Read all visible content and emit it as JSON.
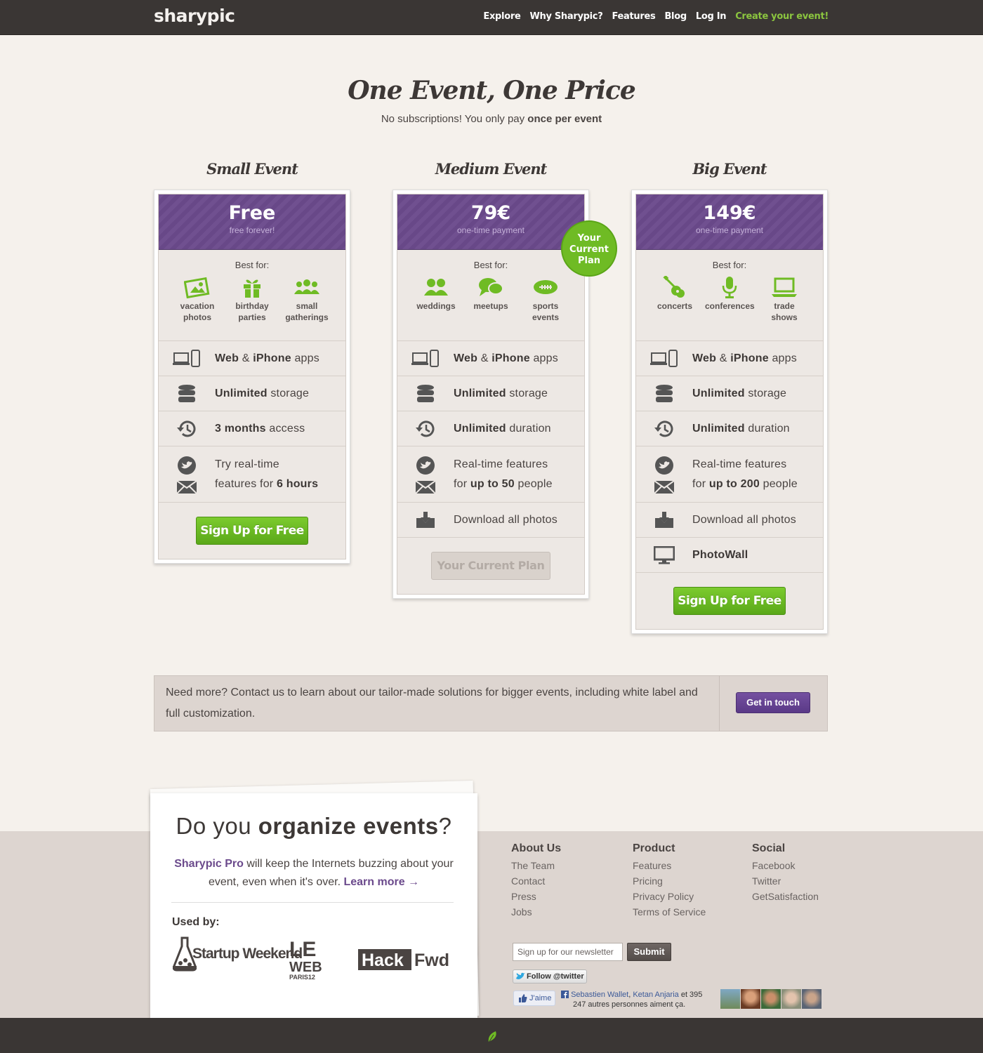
{
  "topbar": {
    "logo": "sharypic",
    "nav": [
      "Explore",
      "Why Sharypic?",
      "Features",
      "Blog",
      "Log In"
    ],
    "cta": "Create your event!"
  },
  "hero": {
    "title": "One Event, One Price",
    "subtitle_pre": "No subscriptions! You only pay ",
    "subtitle_bold": "once per event"
  },
  "plans": [
    {
      "name": "Small Event",
      "price": "Free",
      "price_note": "free forever!",
      "best_for_label": "Best for:",
      "uses": [
        {
          "icon": "vacation-photos-icon",
          "line1": "vacation",
          "line2": "photos"
        },
        {
          "icon": "gift-icon",
          "line1": "birthday",
          "line2": "parties"
        },
        {
          "icon": "group-icon",
          "line1": "small",
          "line2": "gatherings"
        }
      ],
      "feature_apps": {
        "b1": "Web",
        "mid": " & ",
        "b2": "iPhone",
        "rest": " apps"
      },
      "feature_storage": {
        "b": "Unlimited",
        "rest": " storage"
      },
      "feature_duration": {
        "b": "3 months",
        "rest": " access"
      },
      "feature_realtime": {
        "line1": "Try real-time",
        "line2_pre": "features for ",
        "line2_b": "6 hours"
      },
      "button": "Sign Up for Free"
    },
    {
      "name": "Medium Event",
      "price": "79€",
      "price_note": "one-time payment",
      "best_for_label": "Best for:",
      "badge": "Your Current Plan",
      "uses": [
        {
          "icon": "couple-icon",
          "line1": "weddings",
          "line2": ""
        },
        {
          "icon": "chat-icon",
          "line1": "meetups",
          "line2": ""
        },
        {
          "icon": "football-icon",
          "line1": "sports",
          "line2": "events"
        }
      ],
      "feature_apps": {
        "b1": "Web",
        "mid": " & ",
        "b2": "iPhone",
        "rest": " apps"
      },
      "feature_storage": {
        "b": "Unlimited",
        "rest": " storage"
      },
      "feature_duration": {
        "b": "Unlimited",
        "rest": " duration"
      },
      "feature_realtime": {
        "line1": "Real-time features",
        "line2_pre": "for ",
        "line2_b": "up to 50",
        "line2_post": " people"
      },
      "feature_download": "Download all photos",
      "button": "Your Current Plan"
    },
    {
      "name": "Big Event",
      "price": "149€",
      "price_note": "one-time payment",
      "best_for_label": "Best for:",
      "uses": [
        {
          "icon": "guitar-icon",
          "line1": "concerts",
          "line2": ""
        },
        {
          "icon": "microphone-icon",
          "line1": "conferences",
          "line2": ""
        },
        {
          "icon": "laptop-icon",
          "line1": "trade",
          "line2": "shows"
        }
      ],
      "feature_apps": {
        "b1": "Web",
        "mid": " & ",
        "b2": "iPhone",
        "rest": " apps"
      },
      "feature_storage": {
        "b": "Unlimited",
        "rest": " storage"
      },
      "feature_duration": {
        "b": "Unlimited",
        "rest": " duration"
      },
      "feature_realtime": {
        "line1": "Real-time features",
        "line2_pre": "for ",
        "line2_b": "up to 200",
        "line2_post": " people"
      },
      "feature_download": "Download all photos",
      "feature_photowall": "PhotoWall",
      "button": "Sign Up for Free"
    }
  ],
  "contact": {
    "text": "Need more? Contact us to learn about our tailor-made solutions for bigger events, including white label and full customization.",
    "button": "Get in touch"
  },
  "promo": {
    "title_pre": "Do you ",
    "title_bold": "organize events",
    "title_post": "?",
    "pro_name": "Sharypic Pro",
    "pro_text": " will keep the Internets buzzing about your event, even when it's over. ",
    "learn_more": "Learn more →",
    "used_by": "Used by:",
    "logo_startup": "Startup Weekend",
    "logo_leweb_line1": "LE",
    "logo_leweb_line2": "WEB",
    "logo_leweb_line3": "PARIS12",
    "logo_hack": "Hack",
    "logo_fwd": "Fwd"
  },
  "footer": {
    "columns": [
      {
        "title": "About Us",
        "links": [
          "The Team",
          "Contact",
          "Press",
          "Jobs"
        ]
      },
      {
        "title": "Product",
        "links": [
          "Features",
          "Pricing",
          "Privacy Policy",
          "Terms of Service"
        ]
      },
      {
        "title": "Social",
        "links": [
          "Facebook",
          "Twitter",
          "GetSatisfaction"
        ]
      }
    ],
    "newsletter_placeholder": "Sign up for our newsletter",
    "submit": "Submit",
    "twitter": "Follow @twitter",
    "fb_like": "J'aime",
    "fb_name1": "Sebastien Wallet",
    "fb_sep": ", ",
    "fb_name2": "Ketan Anjaria",
    "fb_rest1": " et 395",
    "fb_rest2": "247 autres personnes aiment ça."
  },
  "colors": {
    "topbar": "#3a3634",
    "purple": "#6b4a8c",
    "green": "#6fbb24",
    "background": "#f5f1ec",
    "footer": "#ddd5d0"
  }
}
